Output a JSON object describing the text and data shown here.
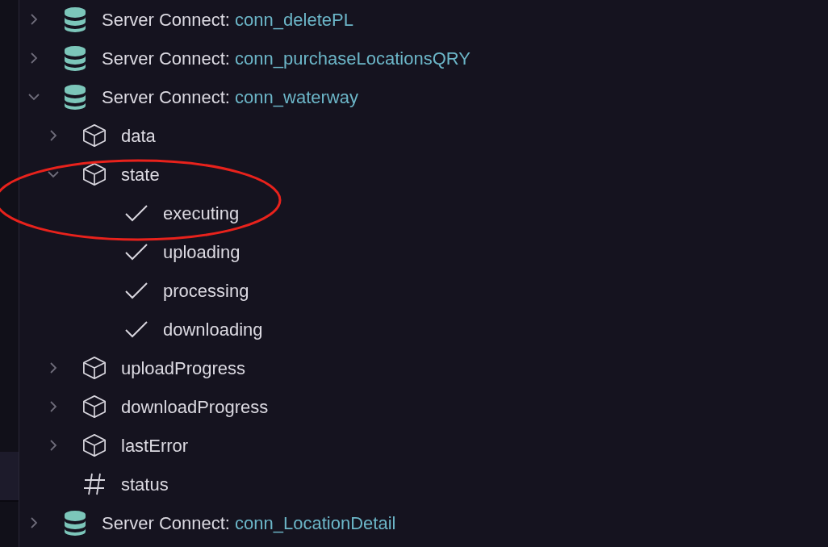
{
  "tree": [
    {
      "kind": "connection",
      "label": "Server Connect:",
      "name": "conn_deletePL",
      "expanded": false
    },
    {
      "kind": "connection",
      "label": "Server Connect:",
      "name": "conn_purchaseLocationsQRY",
      "expanded": false
    },
    {
      "kind": "connection",
      "label": "Server Connect:",
      "name": "conn_waterway",
      "expanded": true,
      "children": [
        {
          "kind": "object",
          "label": "data",
          "expanded": false
        },
        {
          "kind": "object",
          "label": "state",
          "expanded": true,
          "children": [
            {
              "kind": "boolean",
              "label": "executing"
            },
            {
              "kind": "boolean",
              "label": "uploading"
            },
            {
              "kind": "boolean",
              "label": "processing"
            },
            {
              "kind": "boolean",
              "label": "downloading"
            }
          ]
        },
        {
          "kind": "object",
          "label": "uploadProgress",
          "expanded": false
        },
        {
          "kind": "object",
          "label": "downloadProgress",
          "expanded": false
        },
        {
          "kind": "object",
          "label": "lastError",
          "expanded": false
        },
        {
          "kind": "number",
          "label": "status"
        }
      ]
    },
    {
      "kind": "connection",
      "label": "Server Connect:",
      "name": "conn_LocationDetail",
      "expanded": false
    }
  ]
}
